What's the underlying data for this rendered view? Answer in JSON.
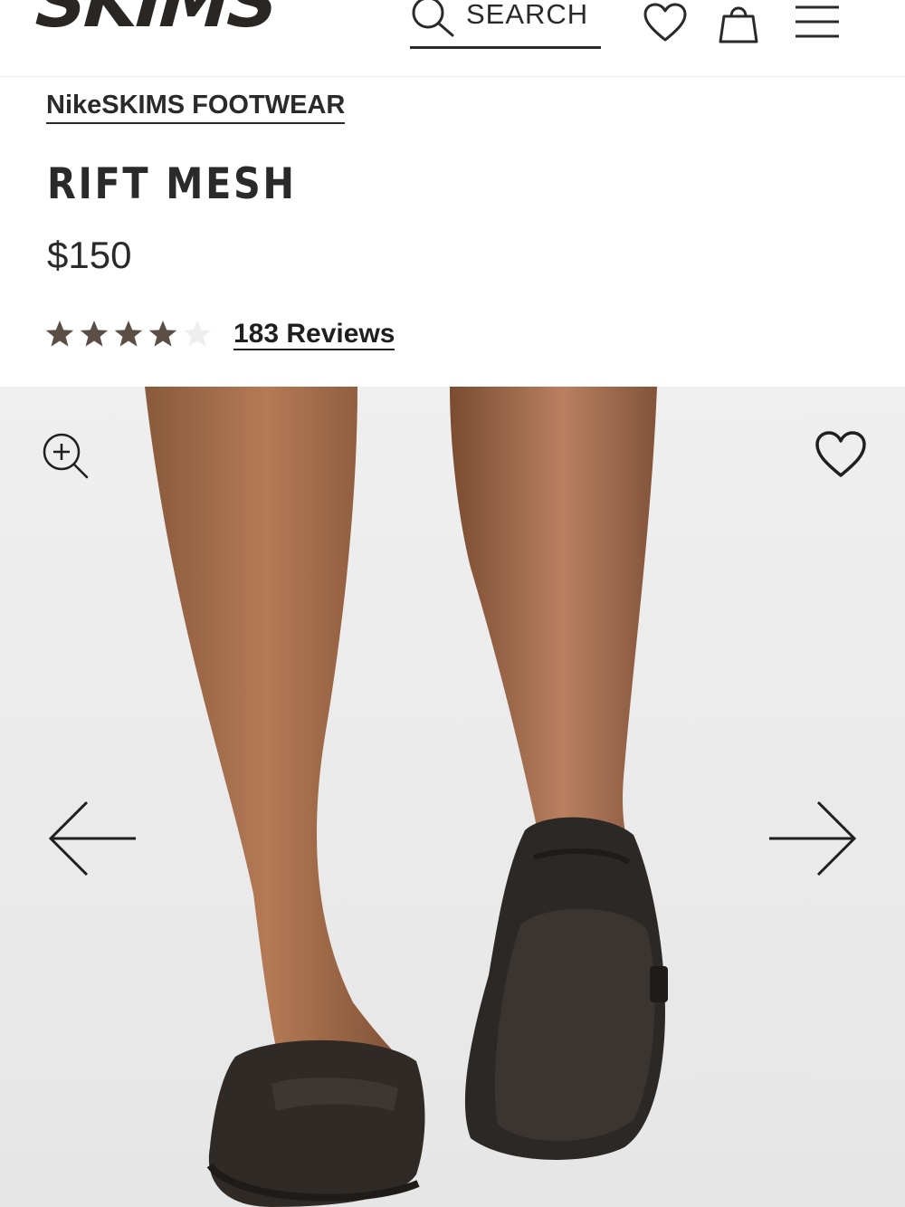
{
  "header": {
    "logo": "SKIMS",
    "search_label": "SEARCH",
    "icons": [
      "search-icon",
      "heart-icon",
      "shopping-bag-icon",
      "menu-icon"
    ]
  },
  "product": {
    "brand": "NikeSKIMS FOOTWEAR",
    "title": "RIFT MESH",
    "price": "$150",
    "rating": 4,
    "rating_max": 5,
    "reviews_label": "183 Reviews"
  },
  "gallery": {
    "icons": [
      "zoom-in-icon",
      "heart-icon",
      "arrow-left-icon",
      "arrow-right-icon"
    ]
  },
  "colors": {
    "text": "#2a2a2a",
    "star_filled": "#5b4e45",
    "star_empty": "#eeeeee",
    "background": "#ffffff",
    "gallery_bg": "#ececec"
  }
}
